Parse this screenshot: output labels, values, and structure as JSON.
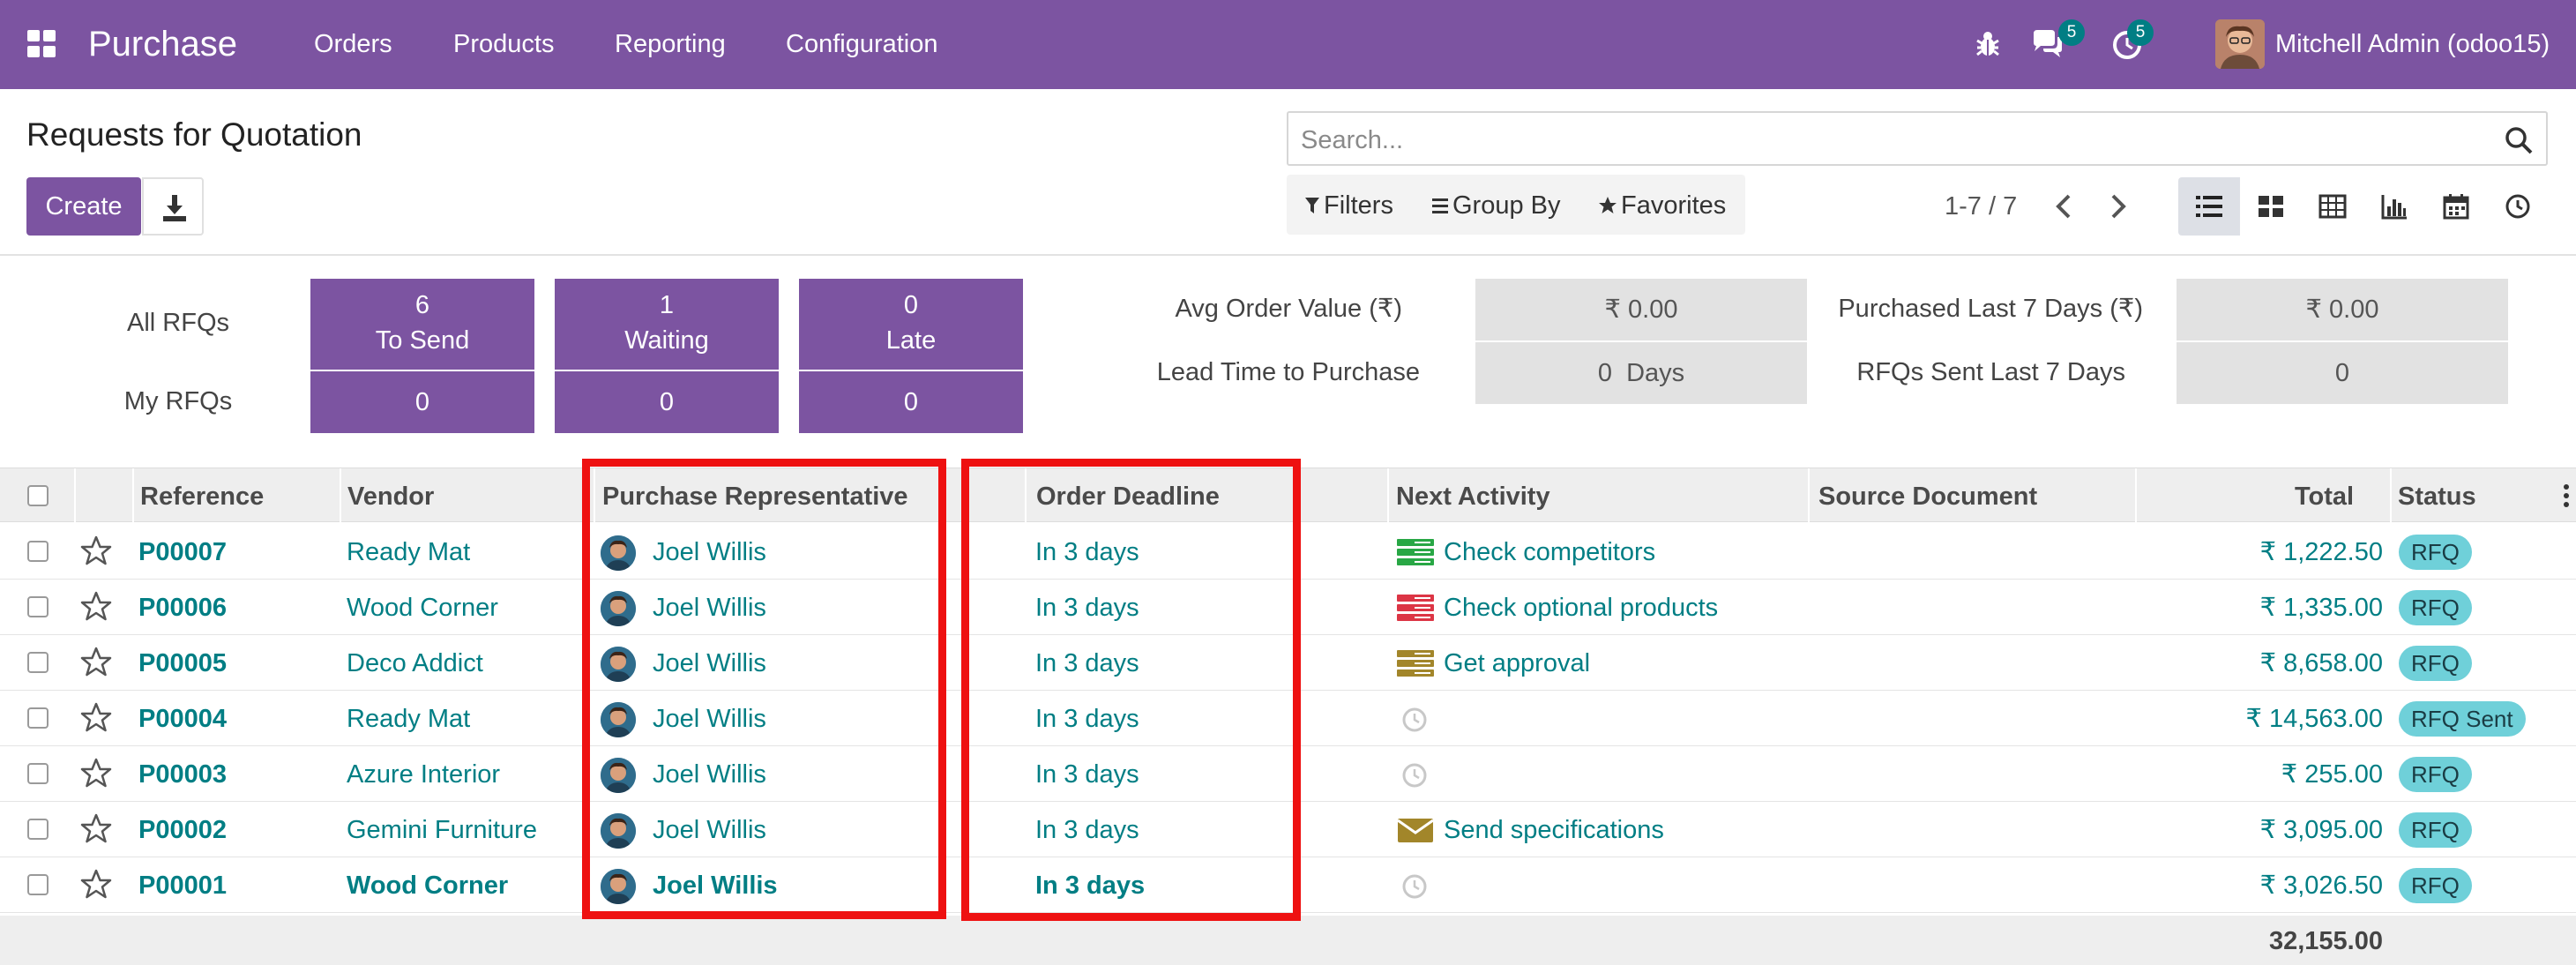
{
  "navbar": {
    "app_name": "Purchase",
    "menu": [
      "Orders",
      "Products",
      "Reporting",
      "Configuration"
    ],
    "messages_count": "5",
    "activities_count": "5",
    "user": "Mitchell Admin (odoo15)",
    "icons": [
      "apps-grid-icon",
      "bug-icon",
      "chat-icon",
      "clock-icon"
    ]
  },
  "control_panel": {
    "title": "Requests for Quotation",
    "create_label": "Create",
    "search_placeholder": "Search...",
    "filters_label": "Filters",
    "group_by_label": "Group By",
    "favorites_label": "Favorites",
    "pager": "1-7 / 7",
    "views": [
      "list",
      "kanban",
      "pivot",
      "graph",
      "calendar",
      "activity"
    ]
  },
  "dashboard": {
    "all_rfqs_label": "All RFQs",
    "my_rfqs_label": "My RFQs",
    "all": [
      {
        "count": "6",
        "label": "To Send"
      },
      {
        "count": "1",
        "label": "Waiting"
      },
      {
        "count": "0",
        "label": "Late"
      }
    ],
    "my": [
      "0",
      "0",
      "0"
    ],
    "kpis": {
      "avg_order_label": "Avg Order Value (₹)",
      "avg_order_value": "₹ 0.00",
      "lead_time_label": "Lead Time to Purchase",
      "lead_time_value": "0  Days",
      "purchased_label": "Purchased Last 7 Days (₹)",
      "purchased_value": "₹ 0.00",
      "sent_label": "RFQs Sent Last 7 Days",
      "sent_value": "0"
    }
  },
  "table": {
    "headers": {
      "reference": "Reference",
      "vendor": "Vendor",
      "representative": "Purchase Representative",
      "deadline": "Order Deadline",
      "activity": "Next Activity",
      "source": "Source Document",
      "total": "Total",
      "status": "Status"
    },
    "rows": [
      {
        "ref": "P00007",
        "vendor": "Ready Mat",
        "rep": "Joel Willis",
        "deadline": "In 3 days",
        "activity": "Check competitors",
        "activity_icon": "task-list-icon",
        "activity_color": "#28a745",
        "source": "",
        "total": "₹ 1,222.50",
        "status": "RFQ"
      },
      {
        "ref": "P00006",
        "vendor": "Wood Corner",
        "rep": "Joel Willis",
        "deadline": "In 3 days",
        "activity": "Check optional products",
        "activity_icon": "task-list-icon",
        "activity_color": "#dc3545",
        "source": "",
        "total": "₹ 1,335.00",
        "status": "RFQ"
      },
      {
        "ref": "P00005",
        "vendor": "Deco Addict",
        "rep": "Joel Willis",
        "deadline": "In 3 days",
        "activity": "Get approval",
        "activity_icon": "task-list-icon",
        "activity_color": "#a2862a",
        "source": "",
        "total": "₹ 8,658.00",
        "status": "RFQ"
      },
      {
        "ref": "P00004",
        "vendor": "Ready Mat",
        "rep": "Joel Willis",
        "deadline": "In 3 days",
        "activity": "",
        "activity_icon": "clock-icon",
        "activity_color": "#c8c8c8",
        "source": "",
        "total": "₹ 14,563.00",
        "status": "RFQ Sent"
      },
      {
        "ref": "P00003",
        "vendor": "Azure Interior",
        "rep": "Joel Willis",
        "deadline": "In 3 days",
        "activity": "",
        "activity_icon": "clock-icon",
        "activity_color": "#c8c8c8",
        "source": "",
        "total": "₹ 255.00",
        "status": "RFQ"
      },
      {
        "ref": "P00002",
        "vendor": "Gemini Furniture",
        "rep": "Joel Willis",
        "deadline": "In 3 days",
        "activity": "Send specifications",
        "activity_icon": "envelope-icon",
        "activity_color": "#a2862a",
        "source": "",
        "total": "₹ 3,095.00",
        "status": "RFQ"
      },
      {
        "ref": "P00001",
        "vendor": "Wood Corner",
        "rep": "Joel Willis",
        "deadline": "In 3 days",
        "activity": "",
        "activity_icon": "clock-icon",
        "activity_color": "#c8c8c8",
        "source": "",
        "total": "₹ 3,026.50",
        "status": "RFQ"
      }
    ],
    "footer_total": "32,155.00"
  },
  "colors": {
    "brand": "#7c54a1",
    "link": "#017e84",
    "highlight": "#ee1111",
    "status_badge": "#6fd0d9"
  }
}
